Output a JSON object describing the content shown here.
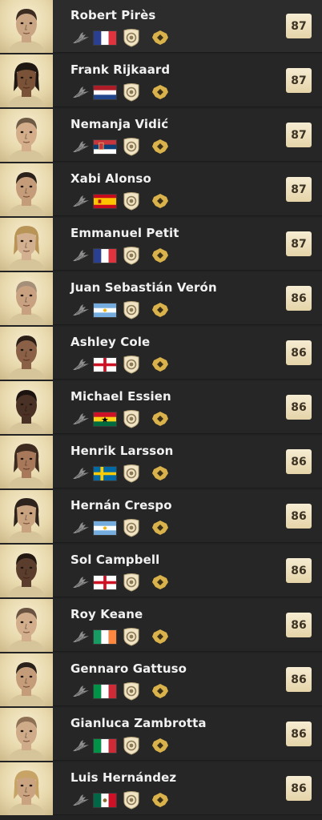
{
  "colors": {
    "background": "#262626",
    "rating_bg": "#efe2c1",
    "rating_text": "#3c3223",
    "chem_icon": "#d9b24c",
    "name_text": "#f1f1f1"
  },
  "players": [
    {
      "name": "Robert Pirès",
      "rating": "87",
      "flag": "france",
      "skin": "#caa583",
      "hair": "#3c2b20"
    },
    {
      "name": "Frank Rijkaard",
      "rating": "87",
      "flag": "netherlands",
      "skin": "#7a5238",
      "hair": "#1f1712"
    },
    {
      "name": "Nemanja Vidić",
      "rating": "87",
      "flag": "serbia",
      "skin": "#d4ae8b",
      "hair": "#6e5a45"
    },
    {
      "name": "Xabi Alonso",
      "rating": "87",
      "flag": "spain",
      "skin": "#c59c79",
      "hair": "#2b211b"
    },
    {
      "name": "Emmanuel Petit",
      "rating": "87",
      "flag": "france",
      "skin": "#d3b08f",
      "hair": "#b89457"
    },
    {
      "name": "Juan Sebastián Verón",
      "rating": "86",
      "flag": "argentina",
      "skin": "#c8a181",
      "hair": "#a58f78"
    },
    {
      "name": "Ashley Cole",
      "rating": "86",
      "flag": "england",
      "skin": "#8a6146",
      "hair": "#2a1e17"
    },
    {
      "name": "Michael Essien",
      "rating": "86",
      "flag": "ghana",
      "skin": "#4a3125",
      "hair": "#1b130f"
    },
    {
      "name": "Henrik Larsson",
      "rating": "86",
      "flag": "sweden",
      "skin": "#a7795a",
      "hair": "#3d2b20"
    },
    {
      "name": "Hernán Crespo",
      "rating": "86",
      "flag": "argentina",
      "skin": "#c9a27f",
      "hair": "#2f241d"
    },
    {
      "name": "Sol Campbell",
      "rating": "86",
      "flag": "england",
      "skin": "#5a3d2d",
      "hair": "#221711"
    },
    {
      "name": "Roy Keane",
      "rating": "86",
      "flag": "ireland",
      "skin": "#d3ae8c",
      "hair": "#6a5340"
    },
    {
      "name": "Gennaro Gattuso",
      "rating": "86",
      "flag": "italy",
      "skin": "#c49c79",
      "hair": "#2a211b"
    },
    {
      "name": "Gianluca Zambrotta",
      "rating": "86",
      "flag": "italy",
      "skin": "#cfab8a",
      "hair": "#8e7154"
    },
    {
      "name": "Luis Hernández",
      "rating": "86",
      "flag": "mexico",
      "skin": "#caa381",
      "hair": "#c7a466"
    }
  ],
  "icons": {
    "position": "position-boot-icon",
    "badge": "icon-badge",
    "chemistry": "chemistry-style-icon"
  }
}
